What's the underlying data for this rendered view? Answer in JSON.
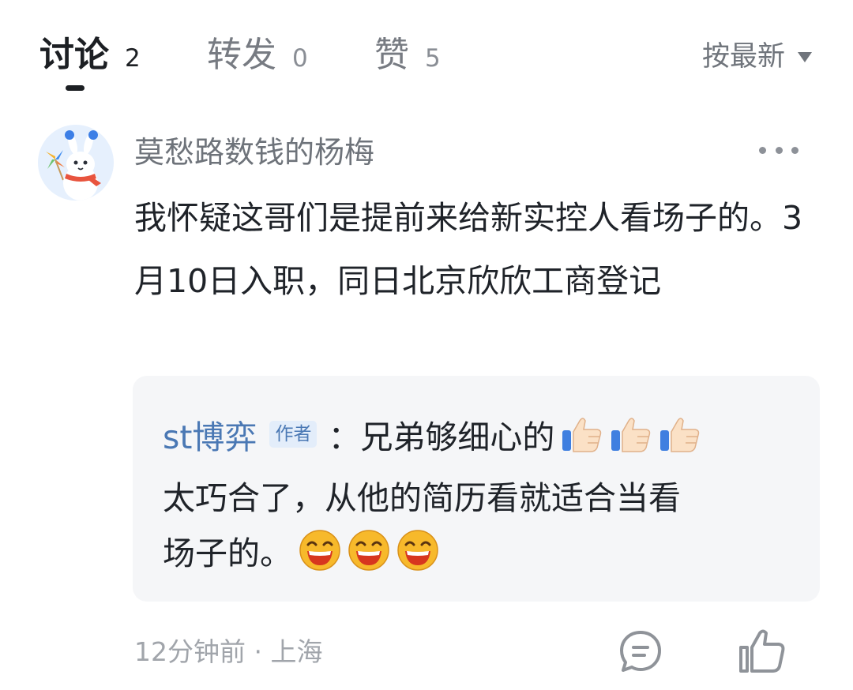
{
  "tabs": [
    {
      "label": "讨论",
      "count": "2",
      "active": true
    },
    {
      "label": "转发",
      "count": "0",
      "active": false
    },
    {
      "label": "赞",
      "count": "5",
      "active": false
    }
  ],
  "sort": {
    "label": "按最新",
    "icon": "caret-down-icon"
  },
  "comment": {
    "username": "莫愁路数钱的杨梅",
    "avatar_icon": "mascot-avatar-icon",
    "text": "我怀疑这哥们是提前来给新实控人看场子的。3月10日入职，同日北京欣欣工商登记",
    "more_icon": "more-dots-icon",
    "reply": {
      "author": "st博弈",
      "badge": "作者",
      "separator": "：",
      "line1_text": "兄弟够细心的",
      "line1_emoji": [
        "thumbs-up-icon",
        "thumbs-up-icon",
        "thumbs-up-icon"
      ],
      "line2_text": "太巧合了，从他的简历看就适合当看",
      "line3_text": "场子的。",
      "line3_emoji": [
        "laughing-face-icon",
        "laughing-face-icon",
        "laughing-face-icon"
      ]
    },
    "meta": "12分钟前 · 上海",
    "reply_icon": "comment-bubble-icon",
    "like_icon": "thumbs-up-outline-icon"
  },
  "colors": {
    "text": "#1f2329",
    "muted": "#777b82",
    "link": "#4a78b4",
    "quote_bg": "#f5f6f8",
    "badge_bg": "#e3edfa"
  }
}
